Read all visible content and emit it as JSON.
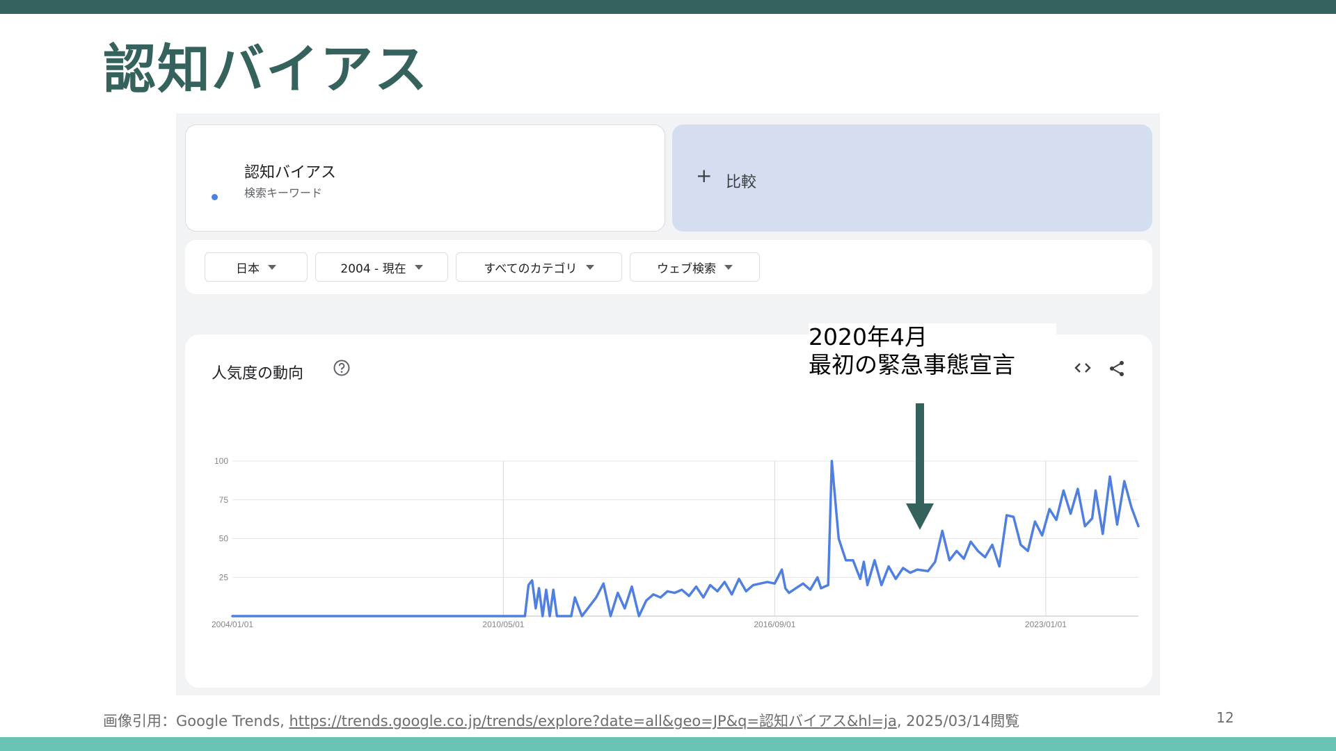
{
  "slide": {
    "title": "認知バイアス",
    "page_number": "12",
    "caption": {
      "prefix": "画像引用：Google Trends, ",
      "url": "https://trends.google.co.jp/trends/explore?date=all&geo=JP&q=認知バイアス&hl=ja",
      "suffix": ", 2025/03/14閲覧"
    },
    "annotation": {
      "line1": "2020年4月",
      "line2": "最初の緊急事態宣言"
    },
    "colors": {
      "accent": "#35625d",
      "footer_bar": "#6ac4b6",
      "series": "#4f7fe0"
    }
  },
  "trends": {
    "term": {
      "name": "認知バイアス",
      "sublabel": "検索キーワード"
    },
    "compare": {
      "label": "比較",
      "icon": "plus-icon"
    },
    "filters": [
      {
        "label": "日本"
      },
      {
        "label": "2004 - 現在"
      },
      {
        "label": "すべてのカテゴリ"
      },
      {
        "label": "ウェブ検索"
      }
    ],
    "chart_title": "人気度の動向",
    "icons": [
      "help-icon",
      "download-icon",
      "embed-icon",
      "share-icon"
    ]
  },
  "chart_data": {
    "type": "line",
    "xlabel": "",
    "ylabel": "",
    "ylim": [
      0,
      100
    ],
    "y_ticks": [
      "100",
      "75",
      "50",
      "25"
    ],
    "x_ticks": [
      "2004/01/01",
      "2010/05/01",
      "2016/09/01",
      "2023/01/01"
    ],
    "grid": true,
    "x_range": [
      "2004/01/01",
      "2025/03/01"
    ],
    "series": [
      {
        "points": [
          [
            "2004/01/01",
            0
          ],
          [
            "2010/11/01",
            0
          ],
          [
            "2010/12/01",
            20
          ],
          [
            "2011/01/01",
            23
          ],
          [
            "2011/02/01",
            5
          ],
          [
            "2011/03/01",
            18
          ],
          [
            "2011/04/01",
            0
          ],
          [
            "2011/05/01",
            17
          ],
          [
            "2011/06/01",
            0
          ],
          [
            "2011/07/01",
            17
          ],
          [
            "2011/08/01",
            0
          ],
          [
            "2011/12/01",
            0
          ],
          [
            "2012/01/01",
            12
          ],
          [
            "2012/03/01",
            0
          ],
          [
            "2012/07/01",
            12
          ],
          [
            "2012/09/01",
            21
          ],
          [
            "2012/11/01",
            0
          ],
          [
            "2013/01/01",
            15
          ],
          [
            "2013/03/01",
            5
          ],
          [
            "2013/05/01",
            19
          ],
          [
            "2013/07/01",
            0
          ],
          [
            "2013/09/01",
            10
          ],
          [
            "2013/11/01",
            14
          ],
          [
            "2014/01/01",
            12
          ],
          [
            "2014/03/01",
            16
          ],
          [
            "2014/05/01",
            15
          ],
          [
            "2014/07/01",
            17
          ],
          [
            "2014/09/01",
            13
          ],
          [
            "2014/11/01",
            19
          ],
          [
            "2015/01/01",
            12
          ],
          [
            "2015/03/01",
            20
          ],
          [
            "2015/05/01",
            16
          ],
          [
            "2015/07/01",
            22
          ],
          [
            "2015/09/01",
            14
          ],
          [
            "2015/11/01",
            24
          ],
          [
            "2016/01/01",
            16
          ],
          [
            "2016/03/01",
            20
          ],
          [
            "2016/05/01",
            21
          ],
          [
            "2016/07/01",
            22
          ],
          [
            "2016/09/01",
            21
          ],
          [
            "2016/11/01",
            30
          ],
          [
            "2016/12/01",
            18
          ],
          [
            "2017/01/01",
            15
          ],
          [
            "2017/03/01",
            18
          ],
          [
            "2017/05/01",
            21
          ],
          [
            "2017/07/01",
            17
          ],
          [
            "2017/09/01",
            25
          ],
          [
            "2017/10/01",
            18
          ],
          [
            "2017/12/01",
            20
          ],
          [
            "2018/01/01",
            100
          ],
          [
            "2018/03/01",
            50
          ],
          [
            "2018/05/01",
            36
          ],
          [
            "2018/07/01",
            36
          ],
          [
            "2018/09/01",
            24
          ],
          [
            "2018/10/01",
            35
          ],
          [
            "2018/11/01",
            20
          ],
          [
            "2019/01/01",
            36
          ],
          [
            "2019/03/01",
            20
          ],
          [
            "2019/05/01",
            32
          ],
          [
            "2019/07/01",
            24
          ],
          [
            "2019/09/01",
            31
          ],
          [
            "2019/11/01",
            28
          ],
          [
            "2020/01/01",
            30
          ],
          [
            "2020/04/01",
            29
          ],
          [
            "2020/06/01",
            35
          ],
          [
            "2020/08/01",
            55
          ],
          [
            "2020/10/01",
            36
          ],
          [
            "2020/12/01",
            42
          ],
          [
            "2021/02/01",
            37
          ],
          [
            "2021/04/01",
            48
          ],
          [
            "2021/06/01",
            42
          ],
          [
            "2021/08/01",
            38
          ],
          [
            "2021/10/01",
            46
          ],
          [
            "2021/12/01",
            32
          ],
          [
            "2022/02/01",
            65
          ],
          [
            "2022/04/01",
            64
          ],
          [
            "2022/06/01",
            46
          ],
          [
            "2022/08/01",
            42
          ],
          [
            "2022/10/01",
            61
          ],
          [
            "2022/12/01",
            52
          ],
          [
            "2023/02/01",
            69
          ],
          [
            "2023/04/01",
            62
          ],
          [
            "2023/06/01",
            81
          ],
          [
            "2023/08/01",
            66
          ],
          [
            "2023/10/01",
            82
          ],
          [
            "2023/12/01",
            58
          ],
          [
            "2024/02/01",
            63
          ],
          [
            "2024/03/01",
            81
          ],
          [
            "2024/05/01",
            53
          ],
          [
            "2024/07/01",
            90
          ],
          [
            "2024/09/01",
            59
          ],
          [
            "2024/11/01",
            87
          ],
          [
            "2025/01/01",
            70
          ],
          [
            "2025/03/01",
            58
          ]
        ]
      }
    ]
  }
}
